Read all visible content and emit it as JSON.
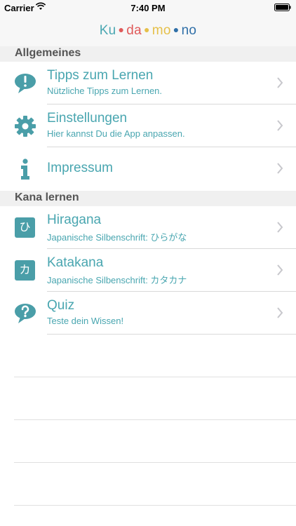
{
  "status_bar": {
    "carrier": "Carrier",
    "time": "7:40 PM"
  },
  "nav": {
    "logo": {
      "parts": [
        "Ku",
        "da",
        "mo",
        "no"
      ],
      "colors": [
        "#4aa7b2",
        "#e05a5a",
        "#e5c04a",
        "#2f6fa8"
      ],
      "dot_colors": [
        "#e05a5a",
        "#e5c04a",
        "#2f6fa8"
      ]
    }
  },
  "sections": [
    {
      "header": "Allgemeines",
      "rows": [
        {
          "icon": "speech-bubble-exclamation-icon",
          "title": "Tipps zum Lernen",
          "subtitle": "Nützliche Tipps zum Lernen."
        },
        {
          "icon": "gear-icon",
          "title": "Einstellungen",
          "subtitle": "Hier kannst Du die App anpassen."
        },
        {
          "icon": "info-icon",
          "title": "Impressum",
          "subtitle": ""
        }
      ]
    },
    {
      "header": "Kana lernen",
      "rows": [
        {
          "icon": "hiragana-icon",
          "icon_text": "ひ",
          "title": "Hiragana",
          "subtitle": "Japanische Silbenschrift: ひらがな"
        },
        {
          "icon": "katakana-icon",
          "icon_text": "カ",
          "title": "Katakana",
          "subtitle": "Japanische Silbenschrift: カタカナ"
        },
        {
          "icon": "speech-bubble-question-icon",
          "title": "Quiz",
          "subtitle": "Teste dein Wissen!"
        }
      ]
    }
  ],
  "colors": {
    "accent": "#49a6b0",
    "icon": "#4a9ea8",
    "separator": "#d9d9d9",
    "section_bg": "#f0f0f0"
  }
}
